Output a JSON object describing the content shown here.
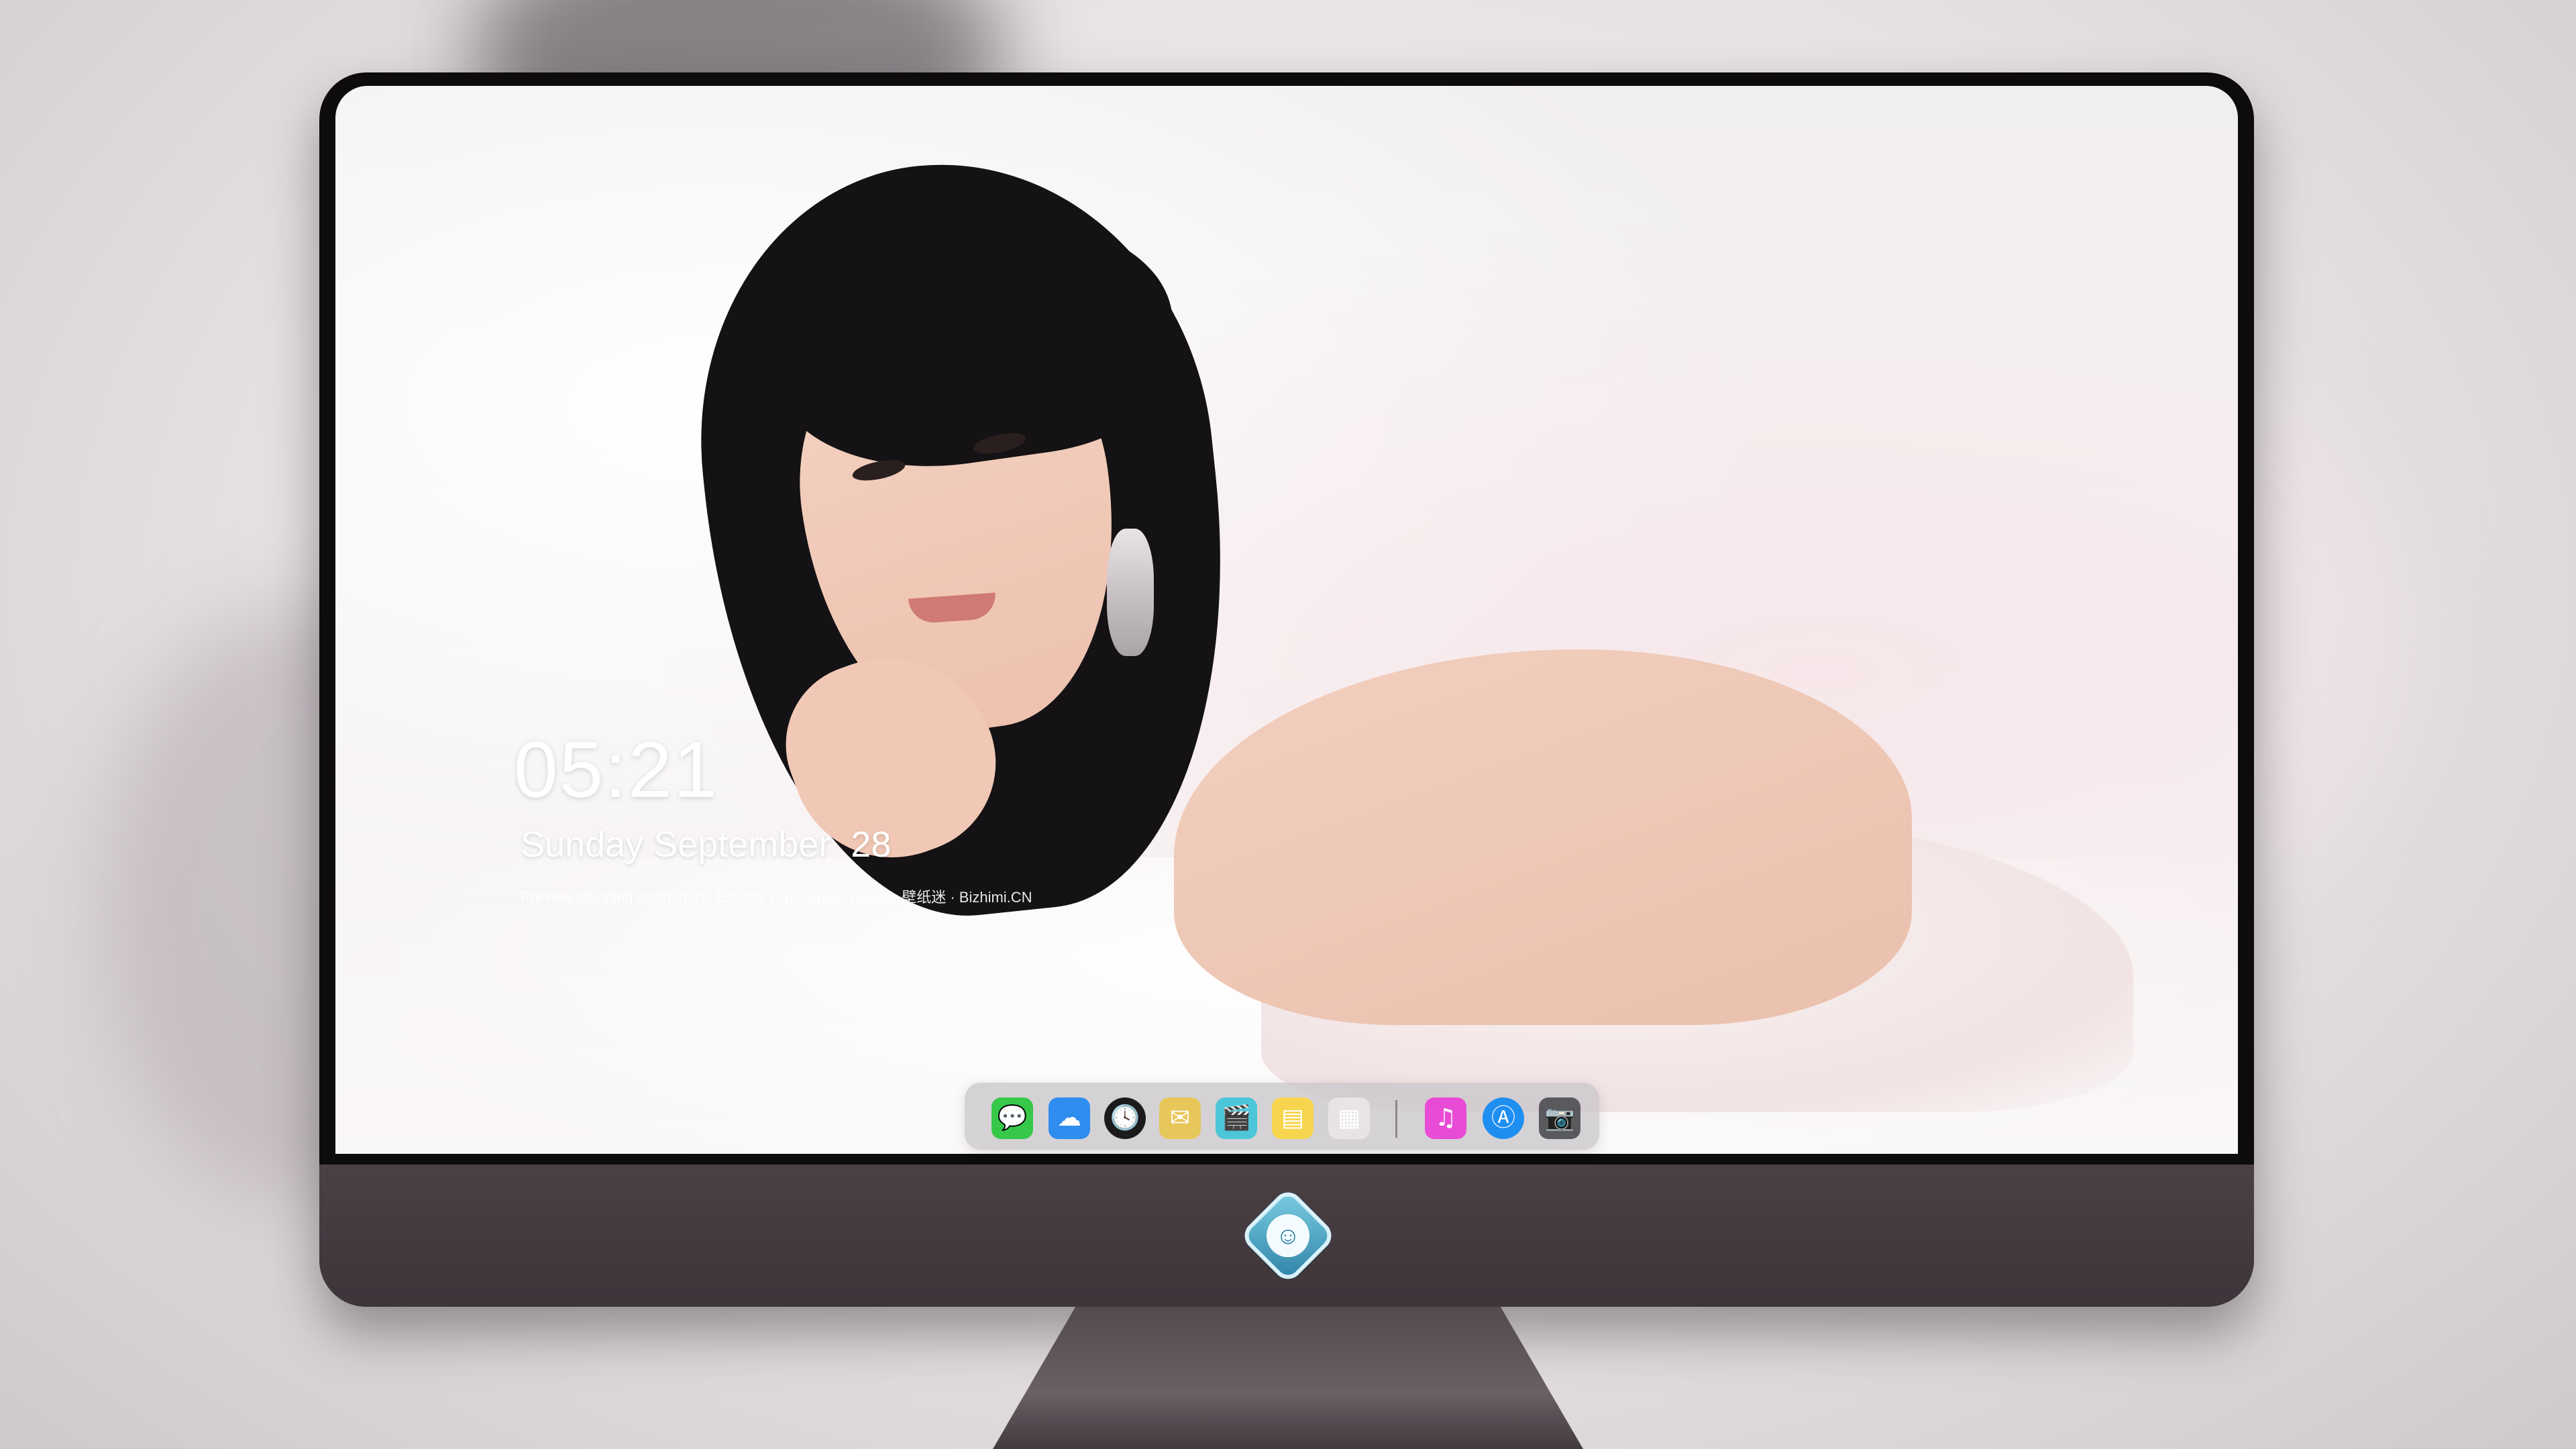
{
  "lockscreen": {
    "time": "05:21",
    "date": "Sunday September  28",
    "tagline": "Preview stunning wallpapers. Elevate your screen beauty. 壁纸迷 · Bizhimi.CN"
  },
  "dock": {
    "apps": [
      {
        "name": "Messages",
        "icon": "messages-icon",
        "color": "#37c84a",
        "glyph": "💬"
      },
      {
        "name": "Weather",
        "icon": "weather-icon",
        "color": "#2f8df0",
        "glyph": "☁"
      },
      {
        "name": "Clock",
        "icon": "clock-icon",
        "color": "#1b1b1b",
        "glyph": "🕓"
      },
      {
        "name": "Preview",
        "icon": "preview-icon",
        "color": "#e8c75a",
        "glyph": "✉"
      },
      {
        "name": "Video",
        "icon": "clapperboard-icon",
        "color": "#4cc6d8",
        "glyph": "🎬"
      },
      {
        "name": "Notes",
        "icon": "notes-icon",
        "color": "#f7d54e",
        "glyph": "▤"
      },
      {
        "name": "Calendar",
        "icon": "calendar-icon",
        "color": "#e8e4e6",
        "glyph": "▦"
      },
      {
        "name": "iTunes",
        "icon": "music-icon",
        "color": "#e84bd6",
        "glyph": "♫"
      },
      {
        "name": "App Store",
        "icon": "app-store-icon",
        "color": "#1f8ef1",
        "glyph": "Ⓐ"
      },
      {
        "name": "Camera",
        "icon": "camera-icon",
        "color": "#5a5a5e",
        "glyph": "📷"
      }
    ]
  }
}
